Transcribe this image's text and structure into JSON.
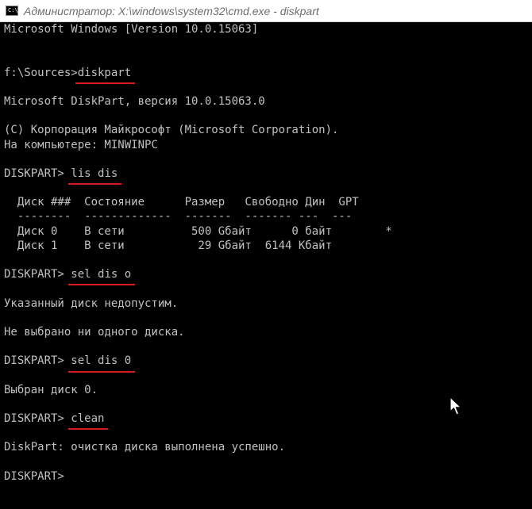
{
  "window": {
    "title": "Администратор: X:\\windows\\system32\\cmd.exe - diskpart",
    "icon_glyph": "C:\\",
    "icon": "cmd-console-icon"
  },
  "console": {
    "lines": [
      {
        "text": "Microsoft Windows [Version 10.0.15063]"
      },
      {
        "text": ""
      },
      {
        "text": ""
      },
      {
        "prompt": "f:\\Sources>",
        "command": "diskpart",
        "highlighted": true
      },
      {
        "text": ""
      },
      {
        "text": "Microsoft DiskPart, версия 10.0.15063.0"
      },
      {
        "text": ""
      },
      {
        "text": "(C) Корпорация Майкрософт (Microsoft Corporation)."
      },
      {
        "text": "На компьютере: MINWINPC"
      },
      {
        "text": ""
      },
      {
        "prompt": "DISKPART> ",
        "command": "lis dis",
        "highlighted": true
      },
      {
        "text": ""
      },
      {
        "text": "  Диск ###  Состояние      Размер   Свободно Дин  GPT"
      },
      {
        "text": "  --------  -------------  -------  ------- ---  ---"
      },
      {
        "text": "  Диск 0    В сети          500 Gбайт      0 байт        *"
      },
      {
        "text": "  Диск 1    В сети           29 Gбайт  6144 Кбайт"
      },
      {
        "text": ""
      },
      {
        "prompt": "DISKPART> ",
        "command": "sel dis o",
        "highlighted": true
      },
      {
        "text": ""
      },
      {
        "text": "Указанный диск недопустим."
      },
      {
        "text": ""
      },
      {
        "text": "Не выбрано ни одного диска."
      },
      {
        "text": ""
      },
      {
        "prompt": "DISKPART> ",
        "command": "sel dis 0",
        "highlighted": true
      },
      {
        "text": ""
      },
      {
        "text": "Выбран диск 0."
      },
      {
        "text": ""
      },
      {
        "prompt": "DISKPART> ",
        "command": "clean",
        "highlighted": true
      },
      {
        "text": ""
      },
      {
        "text": "DiskPart: очистка диска выполнена успешно."
      },
      {
        "text": ""
      },
      {
        "prompt": "DISKPART> ",
        "command": ""
      }
    ]
  },
  "colors": {
    "console_background": "#000000",
    "console_text": "#c0c0c0",
    "highlight_underline": "#d81c1c",
    "titlebar_background": "#ffffff",
    "titlebar_text": "#6e6e6e"
  },
  "mouse_cursor": "arrow-cursor-icon"
}
